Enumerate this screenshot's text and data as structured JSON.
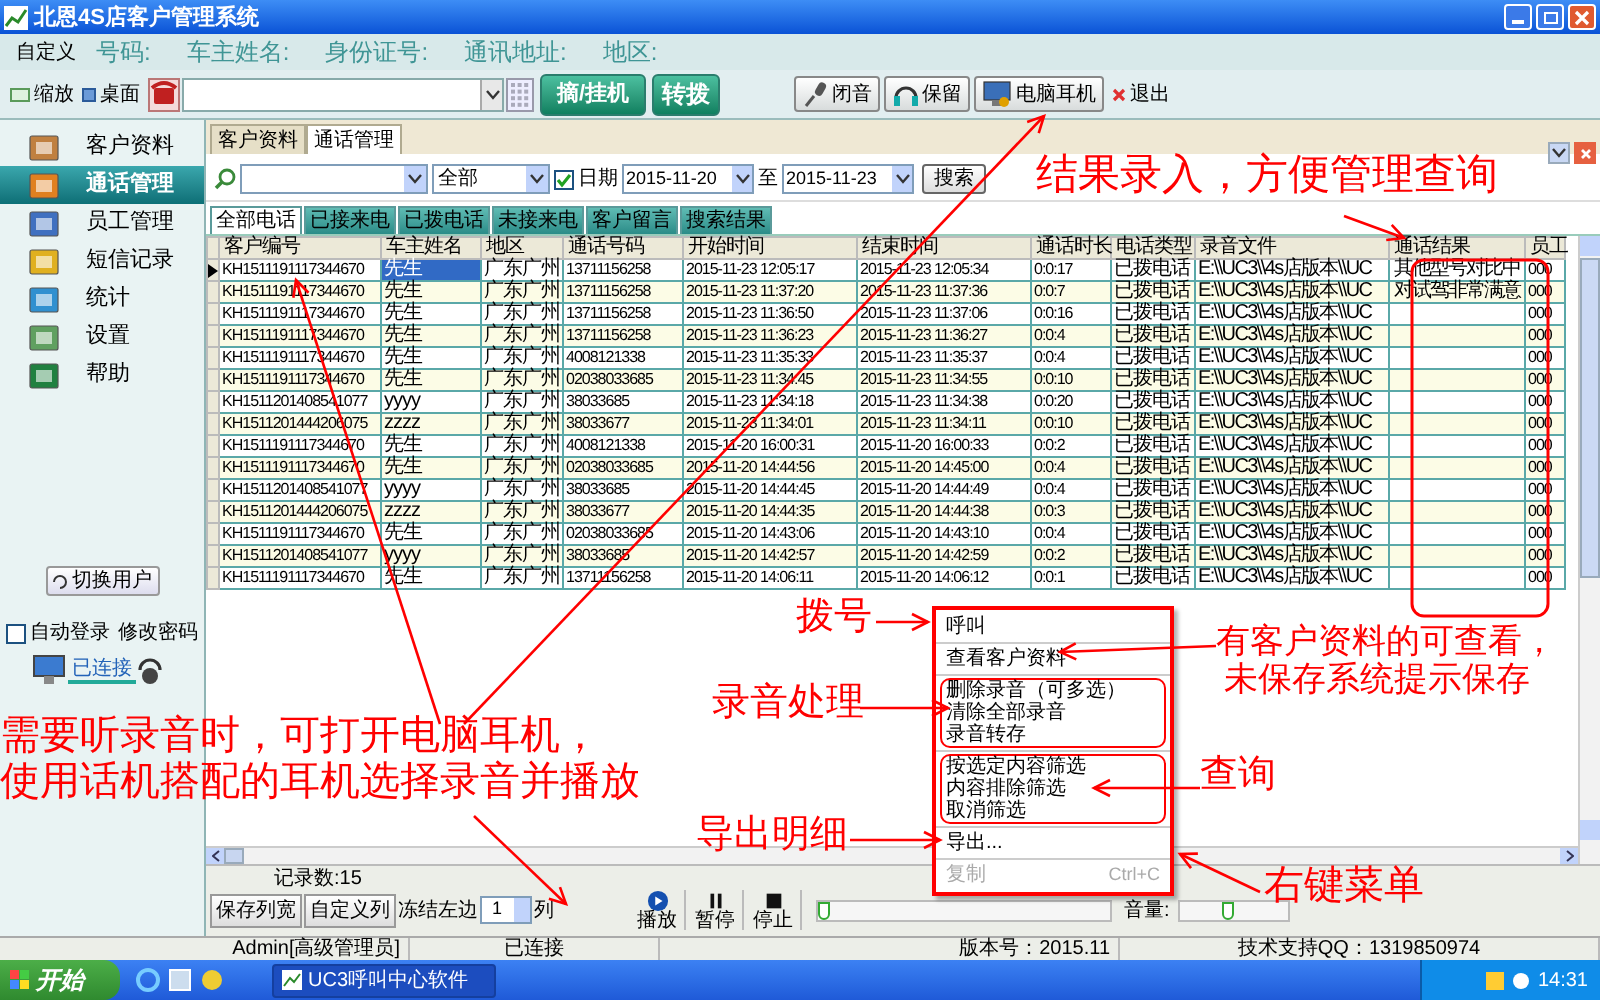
{
  "window": {
    "title": "北恩4S店客户管理系统"
  },
  "info_bar": {
    "custom": "自定义",
    "fields": [
      "号码:",
      "车主姓名:",
      "身份证号:",
      "通讯地址:",
      "地区:"
    ]
  },
  "toolbar": {
    "zoom": "缩放",
    "desktop": "桌面",
    "main_buttons": [
      "摘/挂机",
      "转拨"
    ],
    "call_buttons": [
      {
        "label": "闭音",
        "kind": "mic"
      },
      {
        "label": "保留",
        "kind": "headphones"
      },
      {
        "label": "电脑耳机",
        "kind": "monitor"
      }
    ],
    "exit": "退出"
  },
  "sidebar": {
    "items": [
      {
        "label": "客户资料",
        "selected": false
      },
      {
        "label": "通话管理",
        "selected": true
      },
      {
        "label": "员工管理",
        "selected": false
      },
      {
        "label": "短信记录",
        "selected": false
      },
      {
        "label": "统计",
        "selected": false
      },
      {
        "label": "设置",
        "selected": false
      },
      {
        "label": "帮助",
        "selected": false
      }
    ],
    "switch_user": "切换用户",
    "auto_login": {
      "label": "自动登录",
      "checked": false
    },
    "change_password": "修改密码",
    "connection": "已连接"
  },
  "tabs": [
    {
      "label": "客户资料",
      "selected": false
    },
    {
      "label": "通话管理",
      "selected": true
    }
  ],
  "filter": {
    "type_value": "全部",
    "date_checkbox": {
      "label": "日期",
      "checked": true
    },
    "date_from": "2015-11-20",
    "to": "至",
    "date_to": "2015-11-23",
    "search_button": "搜索"
  },
  "sub_tabs": [
    {
      "label": "全部电话",
      "selected": true
    },
    {
      "label": "已接来电",
      "selected": false
    },
    {
      "label": "已拨电话",
      "selected": false
    },
    {
      "label": "未接来电",
      "selected": false
    },
    {
      "label": "客户留言",
      "selected": false
    },
    {
      "label": "搜索结果",
      "selected": false
    }
  ],
  "table": {
    "columns": [
      "客户编号",
      "车主姓名",
      "地区",
      "通话号码",
      "开始时间",
      "结束时间",
      "通话时长",
      "电话类型",
      "录音文件",
      "通话结果",
      "员工"
    ],
    "rows": [
      {
        "selected": true,
        "cells": [
          "KH1511191117344670",
          "先生",
          "广东广州",
          "13711156258",
          "2015-11-23 12:05:17",
          "2015-11-23 12:05:34",
          "0:0:17",
          "已拨电话",
          "E:\\\\UC3\\\\4s店版本\\\\UC",
          "其他型号对比中",
          "000"
        ]
      },
      {
        "selected": false,
        "cells": [
          "KH1511191117344670",
          "先生",
          "广东广州",
          "13711156258",
          "2015-11-23 11:37:20",
          "2015-11-23 11:37:36",
          "0:0:7",
          "已拨电话",
          "E:\\\\UC3\\\\4s店版本\\\\UC",
          "对试驾非常满意",
          "000"
        ]
      },
      {
        "selected": false,
        "cells": [
          "KH1511191117344670",
          "先生",
          "广东广州",
          "13711156258",
          "2015-11-23 11:36:50",
          "2015-11-23 11:37:06",
          "0:0:16",
          "已拨电话",
          "E:\\\\UC3\\\\4s店版本\\\\UC",
          null,
          "000"
        ]
      },
      {
        "selected": false,
        "cells": [
          "KH1511191117344670",
          "先生",
          "广东广州",
          "13711156258",
          "2015-11-23 11:36:23",
          "2015-11-23 11:36:27",
          "0:0:4",
          "已拨电话",
          "E:\\\\UC3\\\\4s店版本\\\\UC",
          null,
          "000"
        ]
      },
      {
        "selected": false,
        "cells": [
          "KH1511191117344670",
          "先生",
          "广东广州",
          "4008121338",
          "2015-11-23 11:35:33",
          "2015-11-23 11:35:37",
          "0:0:4",
          "已拨电话",
          "E:\\\\UC3\\\\4s店版本\\\\UC",
          null,
          "000"
        ]
      },
      {
        "selected": false,
        "cells": [
          "KH1511191117344670",
          "先生",
          "广东广州",
          "02038033685",
          "2015-11-23 11:34:45",
          "2015-11-23 11:34:55",
          "0:0:10",
          "已拨电话",
          "E:\\\\UC3\\\\4s店版本\\\\UC",
          null,
          "000"
        ]
      },
      {
        "selected": false,
        "cells": [
          "KH1511201408541077",
          "yyyy",
          "广东广州",
          "38033685",
          "2015-11-23 11:34:18",
          "2015-11-23 11:34:38",
          "0:0:20",
          "已拨电话",
          "E:\\\\UC3\\\\4s店版本\\\\UC",
          null,
          "000"
        ]
      },
      {
        "selected": false,
        "cells": [
          "KH1511201444206075",
          "zzzz",
          "广东广州",
          "38033677",
          "2015-11-23 11:34:01",
          "2015-11-23 11:34:11",
          "0:0:10",
          "已拨电话",
          "E:\\\\UC3\\\\4s店版本\\\\UC",
          null,
          "000"
        ]
      },
      {
        "selected": false,
        "cells": [
          "KH1511191117344670",
          "先生",
          "广东广州",
          "4008121338",
          "2015-11-20 16:00:31",
          "2015-11-20 16:00:33",
          "0:0:2",
          "已拨电话",
          "E:\\\\UC3\\\\4s店版本\\\\UC",
          null,
          "000"
        ]
      },
      {
        "selected": false,
        "cells": [
          "KH1511191117344670",
          "先生",
          "广东广州",
          "02038033685",
          "2015-11-20 14:44:56",
          "2015-11-20 14:45:00",
          "0:0:4",
          "已拨电话",
          "E:\\\\UC3\\\\4s店版本\\\\UC",
          null,
          "000"
        ]
      },
      {
        "selected": false,
        "cells": [
          "KH1511201408541077",
          "yyyy",
          "广东广州",
          "38033685",
          "2015-11-20 14:44:45",
          "2015-11-20 14:44:49",
          "0:0:4",
          "已拨电话",
          "E:\\\\UC3\\\\4s店版本\\\\UC",
          null,
          "000"
        ]
      },
      {
        "selected": false,
        "cells": [
          "KH1511201444206075",
          "zzzz",
          "广东广州",
          "38033677",
          "2015-11-20 14:44:35",
          "2015-11-20 14:44:38",
          "0:0:3",
          "已拨电话",
          "E:\\\\UC3\\\\4s店版本\\\\UC",
          null,
          "000"
        ]
      },
      {
        "selected": false,
        "cells": [
          "KH1511191117344670",
          "先生",
          "广东广州",
          "02038033685",
          "2015-11-20 14:43:06",
          "2015-11-20 14:43:10",
          "0:0:4",
          "已拨电话",
          "E:\\\\UC3\\\\4s店版本\\\\UC",
          null,
          "000"
        ]
      },
      {
        "selected": false,
        "cells": [
          "KH1511201408541077",
          "yyyy",
          "广东广州",
          "38033685",
          "2015-11-20 14:42:57",
          "2015-11-20 14:42:59",
          "0:0:2",
          "已拨电话",
          "E:\\\\UC3\\\\4s店版本\\\\UC",
          null,
          "000"
        ]
      },
      {
        "selected": false,
        "cells": [
          "KH1511191117344670",
          "先生",
          "广东广州",
          "13711156258",
          "2015-11-20 14:06:11",
          "2015-11-20 14:06:12",
          "0:0:1",
          "已拨电话",
          "E:\\\\UC3\\\\4s店版本\\\\UC",
          null,
          "000"
        ]
      }
    ]
  },
  "record_count": "记录数:15",
  "bottom_controls": {
    "save_widths": "保存列宽",
    "custom_columns": "自定义列",
    "freeze_label": "冻结左边",
    "freeze_value": "1",
    "freeze_unit": "列",
    "playback": [
      {
        "label": "播放",
        "kind": "play"
      },
      {
        "label": "暂停",
        "kind": "pause"
      },
      {
        "label": "停止",
        "kind": "stop"
      }
    ],
    "progress": {
      "level": 0
    },
    "volume": {
      "label": "音量:",
      "level": 0.45
    }
  },
  "status_bar": [
    "Admin[高级管理员]",
    "已连接",
    "版本号：2015.11",
    "技术支持QQ：1319850974"
  ],
  "context_menu": {
    "groups": [
      {
        "highlighted": false,
        "items": [
          {
            "label": "呼叫",
            "disabled": false
          }
        ]
      },
      {
        "highlighted": false,
        "items": [
          {
            "label": "查看客户资料",
            "disabled": false
          }
        ]
      },
      {
        "highlighted": true,
        "items": [
          {
            "label": "删除录音（可多选）",
            "disabled": false
          },
          {
            "label": "清除全部录音",
            "disabled": false
          },
          {
            "label": "录音转存",
            "disabled": false
          }
        ]
      },
      {
        "highlighted": true,
        "items": [
          {
            "label": "按选定内容筛选",
            "disabled": false
          },
          {
            "label": "内容排除筛选",
            "disabled": false
          },
          {
            "label": "取消筛选",
            "disabled": false
          }
        ]
      },
      {
        "highlighted": false,
        "items": [
          {
            "label": "导出...",
            "disabled": false
          }
        ]
      },
      {
        "highlighted": false,
        "items": [
          {
            "label": "复制",
            "shortcut": "Ctrl+C",
            "disabled": true
          }
        ]
      }
    ]
  },
  "annotations": [
    {
      "text": "结果录入，方便管理查询"
    },
    {
      "text": "拨号"
    },
    {
      "text": "有客户资料的可查看，"
    },
    {
      "text": "未保存系统提示保存"
    },
    {
      "text": "录音处理"
    },
    {
      "text": "需要听录音时，可打开电脑耳机，"
    },
    {
      "text": "使用话机搭配的耳机选择录音并播放"
    },
    {
      "text": "查询"
    },
    {
      "text": "导出明细"
    },
    {
      "text": "右键菜单"
    }
  ],
  "taskbar": {
    "start": "开始",
    "tasks": [
      "UC3呼叫中心软件"
    ],
    "clock": "14:31"
  }
}
